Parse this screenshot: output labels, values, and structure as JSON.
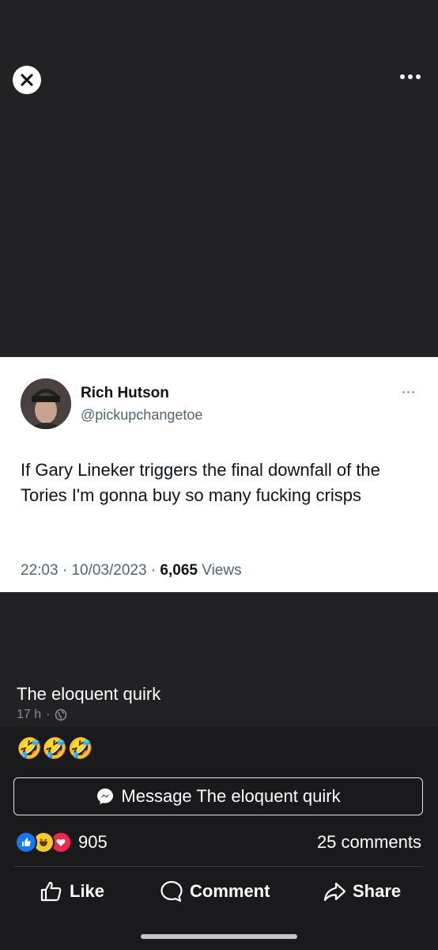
{
  "viewer": {
    "close_icon": "close-icon",
    "more_icon": "more-icon"
  },
  "tweet": {
    "name": "Rich Hutson",
    "handle": "@pickupchangetoe",
    "text": "If Gary Lineker triggers the final downfall of the Tories I'm gonna buy so many fucking crisps",
    "time": "22:03",
    "date": "10/03/2023",
    "views_count": "6,065",
    "views_label": "Views",
    "separator": " · "
  },
  "post": {
    "author": "The eloquent quirk",
    "time": "17 h",
    "dot": "·",
    "caption": "🤣🤣🤣"
  },
  "message_button": {
    "label": "Message The eloquent quirk"
  },
  "stats": {
    "reactions_count": "905",
    "comments": "25 comments"
  },
  "actions": {
    "like": "Like",
    "comment": "Comment",
    "share": "Share"
  },
  "colors": {
    "like_blue": "#1877f2",
    "haha_yellow": "#f7c930",
    "love_red": "#f02849",
    "background": "#1f1f21"
  }
}
